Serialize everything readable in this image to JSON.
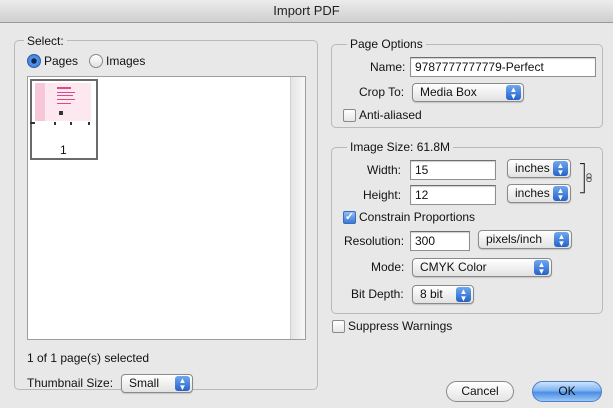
{
  "window": {
    "title": "Import PDF"
  },
  "select": {
    "legend": "Select:",
    "radio_pages": "Pages",
    "radio_images": "Images",
    "thumbnail_page_number": "1",
    "selection_status": "1 of 1 page(s) selected",
    "thumbnail_size_label": "Thumbnail Size:",
    "thumbnail_size_value": "Small"
  },
  "page_options": {
    "legend": "Page Options",
    "name_label": "Name:",
    "name_value": "9787777777779-Perfect",
    "crop_label": "Crop To:",
    "crop_value": "Media Box",
    "anti_aliased_label": "Anti-aliased",
    "anti_aliased": false
  },
  "image_size": {
    "legend": "Image Size: 61.8M",
    "width_label": "Width:",
    "width_value": "15",
    "width_unit": "inches",
    "height_label": "Height:",
    "height_value": "12",
    "height_unit": "inches",
    "constrain_label": "Constrain Proportions",
    "constrain": true,
    "resolution_label": "Resolution:",
    "resolution_value": "300",
    "resolution_unit": "pixels/inch",
    "mode_label": "Mode:",
    "mode_value": "CMYK Color",
    "bitdepth_label": "Bit Depth:",
    "bitdepth_value": "8 bit"
  },
  "suppress_warnings_label": "Suppress Warnings",
  "suppress_warnings": false,
  "buttons": {
    "cancel": "Cancel",
    "ok": "OK"
  },
  "icons": {
    "popup": "updown-arrows-icon",
    "link": "chain-link-icon"
  },
  "colors": {
    "accent": "#3a79d6",
    "window_bg": "#e8e8e8"
  }
}
